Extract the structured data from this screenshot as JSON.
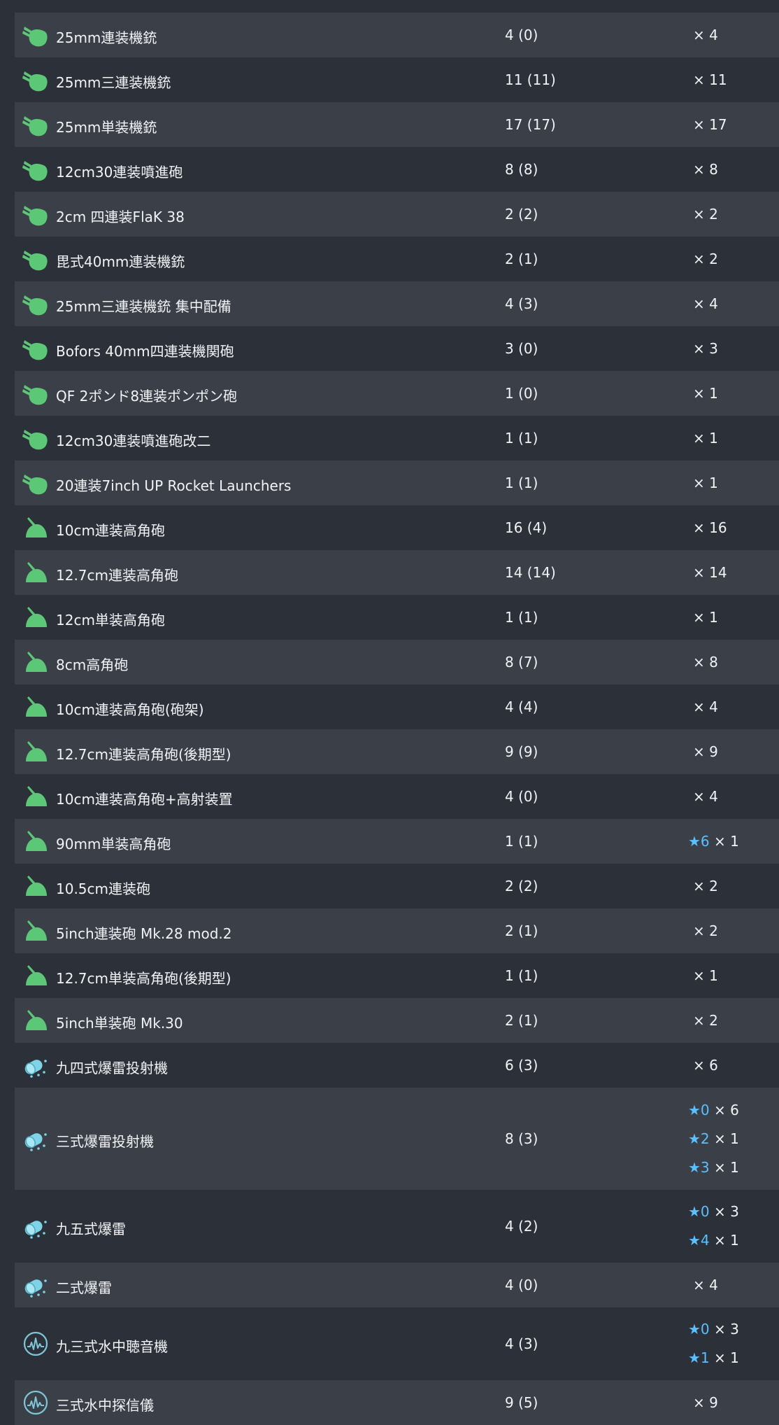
{
  "colors": {
    "row_even": "#3a3f48",
    "row_odd": "#2c3038",
    "text": "#f2f3f5",
    "star": "#5bc0ff",
    "aa_gun_icon": "#5cc777",
    "depth_charge_icon": "#7fd3e6",
    "sonar_icon": "#7fc6d8"
  },
  "items": [
    {
      "icon": "aa-gun-icon",
      "name": "25mm連装機銃",
      "count": "4 (0)",
      "improvements": [
        {
          "star": "",
          "qty": "× 4"
        }
      ]
    },
    {
      "icon": "aa-gun-icon",
      "name": "25mm三連装機銃",
      "count": "11 (11)",
      "improvements": [
        {
          "star": "",
          "qty": "× 11"
        }
      ]
    },
    {
      "icon": "aa-gun-icon",
      "name": "25mm単装機銃",
      "count": "17 (17)",
      "improvements": [
        {
          "star": "",
          "qty": "× 17"
        }
      ]
    },
    {
      "icon": "aa-gun-icon",
      "name": "12cm30連装噴進砲",
      "count": "8 (8)",
      "improvements": [
        {
          "star": "",
          "qty": "× 8"
        }
      ]
    },
    {
      "icon": "aa-gun-icon",
      "name": "2cm 四連装FlaK 38",
      "count": "2 (2)",
      "improvements": [
        {
          "star": "",
          "qty": "× 2"
        }
      ]
    },
    {
      "icon": "aa-gun-icon",
      "name": "毘式40mm連装機銃",
      "count": "2 (1)",
      "improvements": [
        {
          "star": "",
          "qty": "× 2"
        }
      ]
    },
    {
      "icon": "aa-gun-icon",
      "name": "25mm三連装機銃 集中配備",
      "count": "4 (3)",
      "improvements": [
        {
          "star": "",
          "qty": "× 4"
        }
      ]
    },
    {
      "icon": "aa-gun-icon",
      "name": "Bofors 40mm四連装機関砲",
      "count": "3 (0)",
      "improvements": [
        {
          "star": "",
          "qty": "× 3"
        }
      ]
    },
    {
      "icon": "aa-gun-icon",
      "name": "QF 2ポンド8連装ポンポン砲",
      "count": "1 (0)",
      "improvements": [
        {
          "star": "",
          "qty": "× 1"
        }
      ]
    },
    {
      "icon": "aa-gun-icon",
      "name": "12cm30連装噴進砲改二",
      "count": "1 (1)",
      "improvements": [
        {
          "star": "",
          "qty": "× 1"
        }
      ]
    },
    {
      "icon": "aa-gun-icon",
      "name": "20連装7inch UP Rocket Launchers",
      "count": "1 (1)",
      "improvements": [
        {
          "star": "",
          "qty": "× 1"
        }
      ]
    },
    {
      "icon": "ha-gun-icon",
      "name": "10cm連装高角砲",
      "count": "16 (4)",
      "improvements": [
        {
          "star": "",
          "qty": "× 16"
        }
      ]
    },
    {
      "icon": "ha-gun-icon",
      "name": "12.7cm連装高角砲",
      "count": "14 (14)",
      "improvements": [
        {
          "star": "",
          "qty": "× 14"
        }
      ]
    },
    {
      "icon": "ha-gun-icon",
      "name": "12cm単装高角砲",
      "count": "1 (1)",
      "improvements": [
        {
          "star": "",
          "qty": "× 1"
        }
      ]
    },
    {
      "icon": "ha-gun-icon",
      "name": "8cm高角砲",
      "count": "8 (7)",
      "improvements": [
        {
          "star": "",
          "qty": "× 8"
        }
      ]
    },
    {
      "icon": "ha-gun-icon",
      "name": "10cm連装高角砲(砲架)",
      "count": "4 (4)",
      "improvements": [
        {
          "star": "",
          "qty": "× 4"
        }
      ]
    },
    {
      "icon": "ha-gun-icon",
      "name": "12.7cm連装高角砲(後期型)",
      "count": "9 (9)",
      "improvements": [
        {
          "star": "",
          "qty": "× 9"
        }
      ]
    },
    {
      "icon": "ha-gun-icon",
      "name": "10cm連装高角砲+高射装置",
      "count": "4 (0)",
      "improvements": [
        {
          "star": "",
          "qty": "× 4"
        }
      ]
    },
    {
      "icon": "ha-gun-icon",
      "name": "90mm単装高角砲",
      "count": "1 (1)",
      "improvements": [
        {
          "star": "★6",
          "qty": "× 1"
        }
      ]
    },
    {
      "icon": "ha-gun-icon",
      "name": "10.5cm連装砲",
      "count": "2 (2)",
      "improvements": [
        {
          "star": "",
          "qty": "× 2"
        }
      ]
    },
    {
      "icon": "ha-gun-icon",
      "name": "5inch連装砲 Mk.28 mod.2",
      "count": "2 (1)",
      "improvements": [
        {
          "star": "",
          "qty": "× 2"
        }
      ]
    },
    {
      "icon": "ha-gun-icon",
      "name": "12.7cm単装高角砲(後期型)",
      "count": "1 (1)",
      "improvements": [
        {
          "star": "",
          "qty": "× 1"
        }
      ]
    },
    {
      "icon": "ha-gun-icon",
      "name": "5inch単装砲 Mk.30",
      "count": "2 (1)",
      "improvements": [
        {
          "star": "",
          "qty": "× 2"
        }
      ]
    },
    {
      "icon": "depth-charge-icon",
      "name": "九四式爆雷投射機",
      "count": "6 (3)",
      "improvements": [
        {
          "star": "",
          "qty": "× 6"
        }
      ]
    },
    {
      "icon": "depth-charge-icon",
      "name": "三式爆雷投射機",
      "count": "8 (3)",
      "improvements": [
        {
          "star": "★0",
          "qty": "× 6"
        },
        {
          "star": "★2",
          "qty": "× 1"
        },
        {
          "star": "★3",
          "qty": "× 1"
        }
      ]
    },
    {
      "icon": "depth-charge-icon",
      "name": "九五式爆雷",
      "count": "4 (2)",
      "improvements": [
        {
          "star": "★0",
          "qty": "× 3"
        },
        {
          "star": "★4",
          "qty": "× 1"
        }
      ]
    },
    {
      "icon": "depth-charge-icon",
      "name": "二式爆雷",
      "count": "4 (0)",
      "improvements": [
        {
          "star": "",
          "qty": "× 4"
        }
      ]
    },
    {
      "icon": "sonar-icon",
      "name": "九三式水中聴音機",
      "count": "4 (3)",
      "improvements": [
        {
          "star": "★0",
          "qty": "× 3"
        },
        {
          "star": "★1",
          "qty": "× 1"
        }
      ]
    },
    {
      "icon": "sonar-icon",
      "name": "三式水中探信儀",
      "count": "9 (5)",
      "improvements": [
        {
          "star": "",
          "qty": "× 9"
        }
      ]
    }
  ]
}
